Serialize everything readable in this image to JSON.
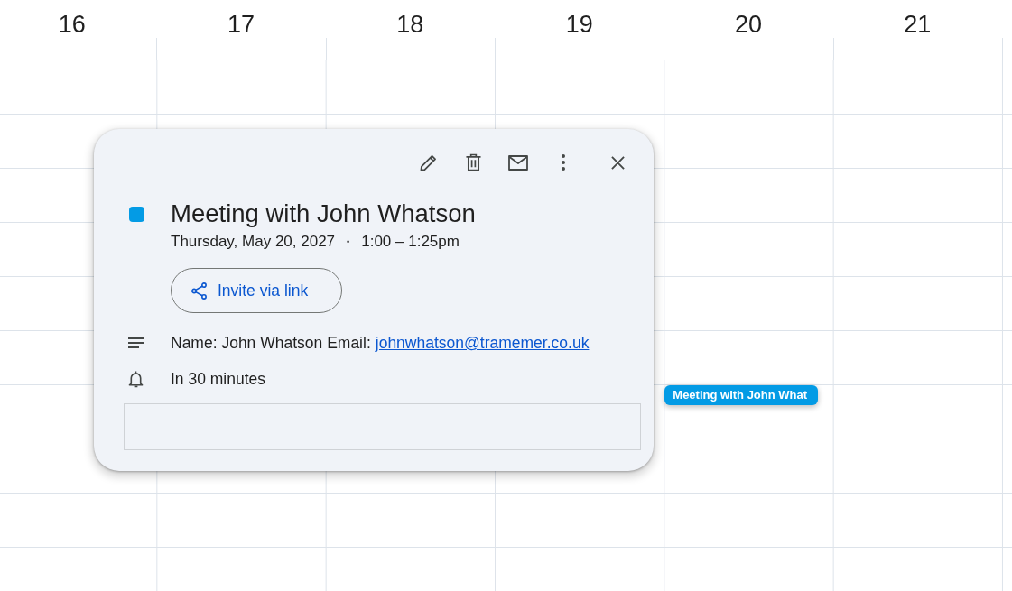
{
  "days": [
    {
      "number": "16"
    },
    {
      "number": "17"
    },
    {
      "number": "18"
    },
    {
      "number": "19"
    },
    {
      "number": "20",
      "events": [
        {
          "title": "Meeting with John What",
          "color": "#039be5"
        }
      ]
    },
    {
      "number": "21"
    }
  ],
  "event_popup": {
    "color": "#039be5",
    "title": "Meeting with John Whatson",
    "date": "Thursday, May 20, 2027",
    "separator": "•",
    "time": "1:00 – 1:25pm",
    "invite_button": "Invite via link",
    "description": {
      "text": "Name: John Whatson Email:",
      "link": "johnwhatson@tramemer.co.uk"
    },
    "reminder": "In 30 minutes"
  }
}
